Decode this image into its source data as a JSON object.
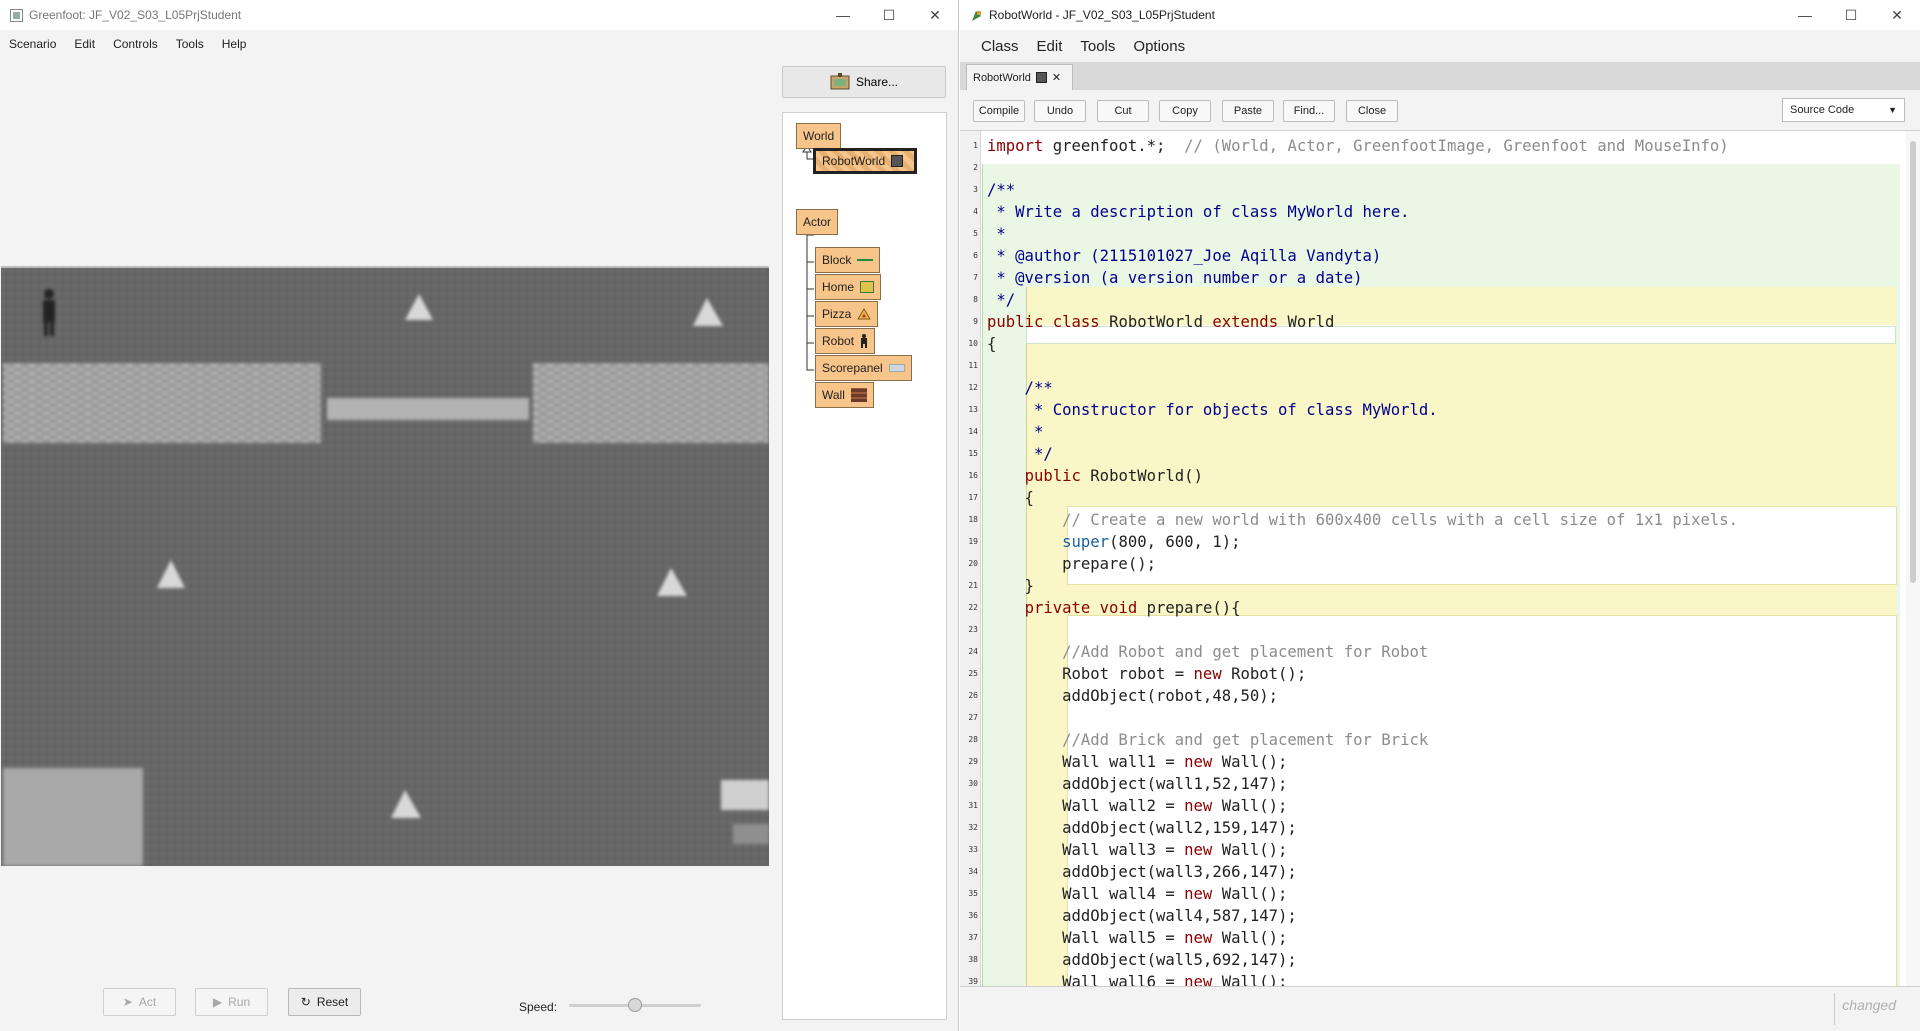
{
  "greenfoot": {
    "title": "Greenfoot: JF_V02_S03_L05PrjStudent",
    "menu": [
      "Scenario",
      "Edit",
      "Controls",
      "Tools",
      "Help"
    ],
    "share_label": "Share...",
    "classes": {
      "world_root": "World",
      "world_sub": "RobotWorld",
      "actor_root": "Actor",
      "actors": [
        "Block",
        "Home",
        "Pizza",
        "Robot",
        "Scorepanel",
        "Wall"
      ]
    },
    "controls": {
      "act": "Act",
      "run": "Run",
      "reset": "Reset",
      "speed_label": "Speed:"
    },
    "speed_fraction": 0.5
  },
  "editor": {
    "title": "RobotWorld - JF_V02_S03_L05PrjStudent",
    "menu": [
      "Class",
      "Edit",
      "Tools",
      "Options"
    ],
    "tab_label": "RobotWorld",
    "toolbar": [
      "Compile",
      "Undo",
      "Cut",
      "Copy",
      "Paste",
      "Find...",
      "Close"
    ],
    "view_select": "Source Code",
    "status": "changed",
    "line_numbers": [
      "1",
      "2",
      "3",
      "4",
      "5",
      "6",
      "7",
      "8",
      "9",
      "10",
      "11",
      "12",
      "13",
      "14",
      "15",
      "16",
      "17",
      "18",
      "19",
      "20",
      "21",
      "22",
      "23",
      "24",
      "25",
      "26",
      "27",
      "28",
      "29",
      "30",
      "31",
      "32",
      "33",
      "34",
      "35",
      "36",
      "37",
      "38",
      "39"
    ],
    "lines": [
      "import greenfoot.*;  // (World, Actor, GreenfootImage, Greenfoot and MouseInfo)",
      "",
      "/**",
      " * Write a description of class MyWorld here.",
      " * ",
      " * @author (2115101027_Joe Aqilla Vandyta)",
      " * @version (a version number or a date)",
      " */",
      "public class RobotWorld extends World",
      "{",
      "",
      "    /**",
      "     * Constructor for objects of class MyWorld.",
      "     * ",
      "     */",
      "    public RobotWorld()",
      "    {",
      "        // Create a new world with 600x400 cells with a cell size of 1x1 pixels.",
      "        super(800, 600, 1);",
      "        prepare();",
      "    }",
      "    private void prepare(){",
      "",
      "        //Add Robot and get placement for Robot",
      "        Robot robot = new Robot();",
      "        addObject(robot,48,50);",
      "",
      "        //Add Brick and get placement for Brick",
      "        Wall wall1 = new Wall();",
      "        addObject(wall1,52,147);",
      "        Wall wall2 = new Wall();",
      "        addObject(wall2,159,147);",
      "        Wall wall3 = new Wall();",
      "        addObject(wall3,266,147);",
      "        Wall wall4 = new Wall();",
      "        addObject(wall4,587,147);",
      "        Wall wall5 = new Wall();",
      "        addObject(wall5,692,147);",
      "        Wall wall6 = new Wall();"
    ]
  }
}
